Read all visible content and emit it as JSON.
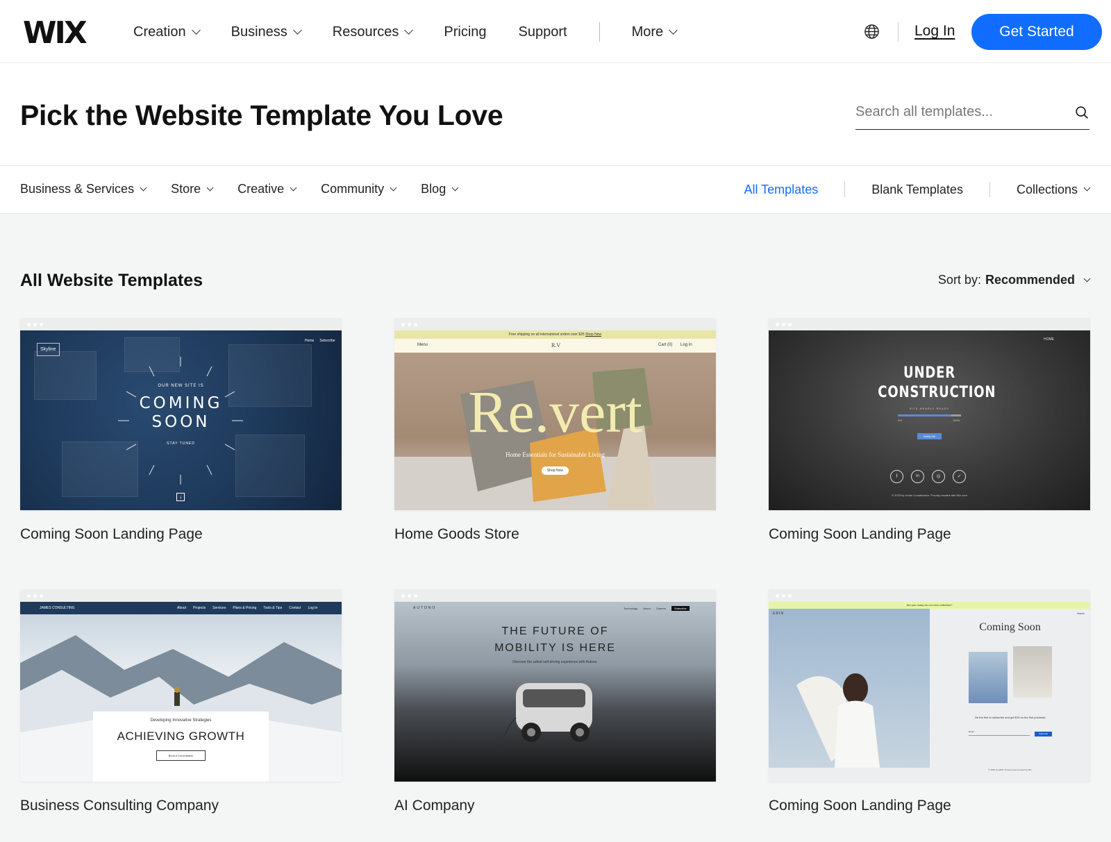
{
  "topnav": {
    "logo": "WIX",
    "items": [
      {
        "label": "Creation",
        "dropdown": true
      },
      {
        "label": "Business",
        "dropdown": true
      },
      {
        "label": "Resources",
        "dropdown": true
      },
      {
        "label": "Pricing",
        "dropdown": false
      },
      {
        "label": "Support",
        "dropdown": false
      }
    ],
    "more_label": "More",
    "globe_icon": "globe-icon",
    "login_label": "Log In",
    "cta_label": "Get Started",
    "accent_color": "#116dff"
  },
  "header": {
    "title": "Pick the Website Template You Love",
    "search_placeholder": "Search all templates...",
    "search_icon": "search-icon"
  },
  "filters": {
    "categories": [
      "Business & Services",
      "Store",
      "Creative",
      "Community",
      "Blog"
    ],
    "views": {
      "all": "All Templates",
      "blank": "Blank Templates",
      "collections": "Collections"
    },
    "active_view": "All Templates"
  },
  "section": {
    "title": "All Website Templates",
    "sort_label": "Sort by:",
    "sort_value": "Recommended"
  },
  "templates": [
    {
      "name": "Coming Soon Landing Page",
      "preview": {
        "brand": "Skyline",
        "nav": [
          "Home",
          "Subscribe"
        ],
        "kicker": "OUR NEW SITE IS",
        "headline": "COMING SOON",
        "sub": "STAY TUNED"
      }
    },
    {
      "name": "Home Goods Store",
      "preview": {
        "banner": "Free shipping on all international orders over $35",
        "banner_link": "Shop Now",
        "menu": "Menu",
        "brand": "R.V",
        "nav": [
          "Cart (0)",
          "Log In"
        ],
        "headline": "Re.vert",
        "sub": "Home Essentials for Sustainable Living",
        "button": "Shop Now"
      }
    },
    {
      "name": "Coming Soon Landing Page",
      "preview": {
        "nav": [
          "HOME"
        ],
        "headline": "UNDER CONSTRUCTION",
        "sub": "SITE NEARLY READY",
        "progress_start": "0%",
        "progress_end": "100%",
        "progress": 0.85,
        "button": "Notify Me",
        "footer": "© 2023 by Under Construction. Proudly created with Wix.com"
      }
    },
    {
      "name": "Business Consulting Company",
      "preview": {
        "brand": "JAMES CONSULTING",
        "nav": [
          "About",
          "Projects",
          "Services",
          "Plans & Pricing",
          "Tools & Tips",
          "Contact",
          "Log In"
        ],
        "kicker": "Developing Innovative Strategies",
        "headline": "ACHIEVING GROWTH",
        "button": "Book A Consultation"
      }
    },
    {
      "name": "AI Company",
      "preview": {
        "brand": "AUTONO",
        "nav": [
          "Technology",
          "About",
          "Careers"
        ],
        "nav_button": "Subscribe",
        "headline_1": "THE FUTURE OF",
        "headline_2": "MOBILITY IS HERE",
        "sub": "Discover the safest self-driving experience with Autono."
      }
    },
    {
      "name": "Coming Soon Landing Page",
      "preview": {
        "banner": "Are you ready for our new collection?",
        "brand": "ERIN",
        "nav": [
          "Home"
        ],
        "headline": "Coming Soon",
        "text": "Be the first to subscribe and get $15 on the first purchase",
        "email_label": "Email",
        "button": "Subscribe",
        "footer": "© 2035 by ERIN. Powered and secured by Wix"
      }
    }
  ]
}
